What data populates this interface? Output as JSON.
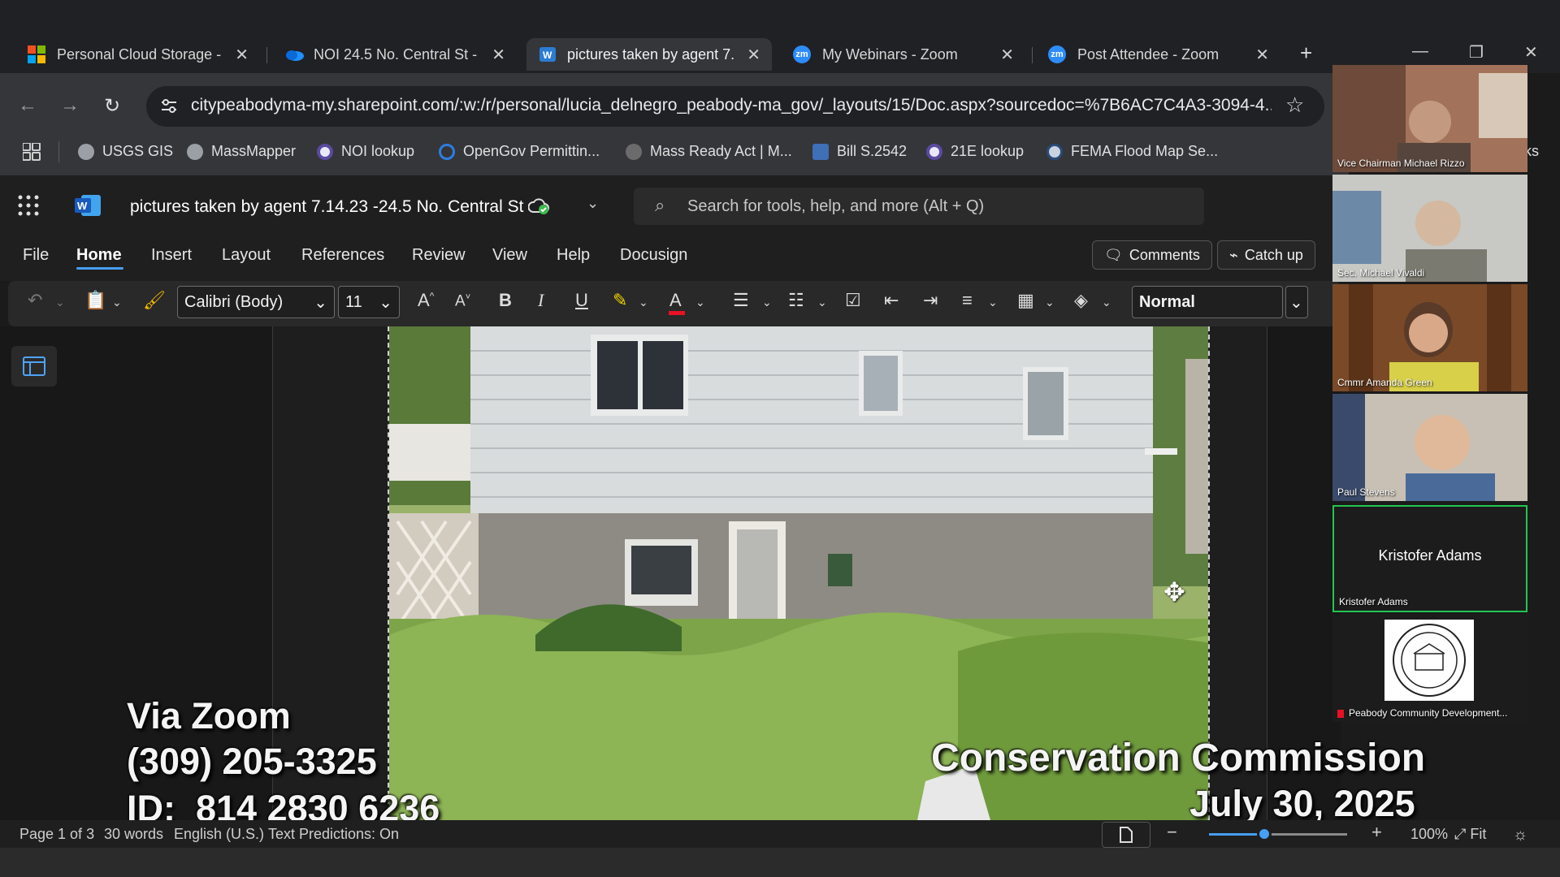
{
  "tabs": [
    {
      "label": "Personal Cloud Storage - ",
      "icon": "microsoft-logo-icon",
      "active": false
    },
    {
      "label": "NOI 24.5 No. Central St - ",
      "icon": "onedrive-icon",
      "active": false
    },
    {
      "label": "pictures taken by agent 7.",
      "icon": "word-icon",
      "active": true
    },
    {
      "label": "My Webinars - Zoom",
      "icon": "zoom-icon",
      "active": false
    },
    {
      "label": "Post Attendee - Zoom",
      "icon": "zoom-icon",
      "active": false
    }
  ],
  "address": {
    "url": "citypeabodyma-my.sharepoint.com/:w:/r/personal/lucia_delnegro_peabody-ma_gov/_layouts/15/Doc.aspx?sourcedoc=%7B6AC7C4A3-3094-4..."
  },
  "bookmarks": [
    {
      "label": "USGS GIS",
      "icon": "globe-icon"
    },
    {
      "label": "MassMapper",
      "icon": "globe-icon"
    },
    {
      "label": "NOI lookup",
      "icon": "shield-icon"
    },
    {
      "label": "OpenGov Permittin...",
      "icon": "opengov-icon"
    },
    {
      "label": "Mass Ready Act | M...",
      "icon": "seal-icon"
    },
    {
      "label": "Bill S.2542",
      "icon": "person-icon"
    },
    {
      "label": "21E lookup",
      "icon": "shield-icon"
    },
    {
      "label": "FEMA Flood Map Se...",
      "icon": "fema-icon"
    }
  ],
  "bookmarks_overflow": "ks",
  "word": {
    "doc_title": "pictures taken by agent 7.14.23 -24.5 No. Central St",
    "search_placeholder": "Search for tools, help, and more (Alt + Q)",
    "menu": [
      "File",
      "Home",
      "Insert",
      "Layout",
      "References",
      "Review",
      "View",
      "Help",
      "Docusign"
    ],
    "active_menu": "Home",
    "comments_label": "Comments",
    "catchup_label": "Catch up",
    "font_name": "Calibri (Body)",
    "font_size": "11",
    "style_name": "Normal",
    "accent": "#479ef5"
  },
  "status": {
    "page": "Page 1 of 3",
    "words": "30 words",
    "language": "English (U.S.)",
    "predictions": "Text Predictions: On",
    "zoom": "100%",
    "fit": "Fit",
    "zoom_level": 0.4
  },
  "overlay": {
    "via": "Via Zoom",
    "phone": "(309) 205-3325",
    "id": "ID:  814 2830 6236",
    "commission": "Conservation Commission",
    "date": "July 30, 2025"
  },
  "participants": [
    {
      "name": "Vice Chairman Michael Rizzo",
      "video": true
    },
    {
      "name": "Sec. Michael Vivaldi",
      "video": true
    },
    {
      "name": "Cmmr Amanda Green",
      "video": true
    },
    {
      "name": "Paul Stevens",
      "video": true
    },
    {
      "name": "Kristofer Adams",
      "display": "Kristofer Adams",
      "video": false,
      "speaking": true
    },
    {
      "name": "Peabody Community Development...",
      "video": false,
      "logo": true
    }
  ]
}
